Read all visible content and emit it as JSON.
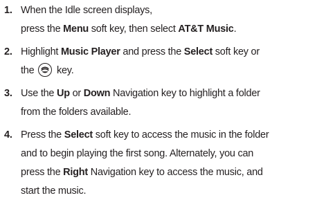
{
  "steps": [
    {
      "number": "1.",
      "line1": "When the Idle screen displays,",
      "l2_a": "press the ",
      "l2_b": "Menu",
      "l2_c": " soft key, then select ",
      "l2_d": "AT&T Music",
      "l2_e": "."
    },
    {
      "number": "2.",
      "l1_a": "Highlight ",
      "l1_b": "Music Player",
      "l1_c": " and press the ",
      "l1_d": "Select",
      "l1_e": " soft key or",
      "l2_a": "the ",
      "l2_icon": "select-key-icon",
      "l2_b": " key."
    },
    {
      "number": "3.",
      "l1_a": "Use the ",
      "l1_b": "Up",
      "l1_c": " or ",
      "l1_d": "Down",
      "l1_e": " Navigation key to highlight a folder",
      "l2": "from the folders available."
    },
    {
      "number": "4.",
      "l1_a": "Press the ",
      "l1_b": "Select",
      "l1_c": " soft key to access the music in the folder",
      "l2": "and to begin playing the first song. Alternately, you can",
      "l3_a": "press the ",
      "l3_b": "Right",
      "l3_c": " Navigation key to access the music, and",
      "l4": "start the music."
    }
  ]
}
